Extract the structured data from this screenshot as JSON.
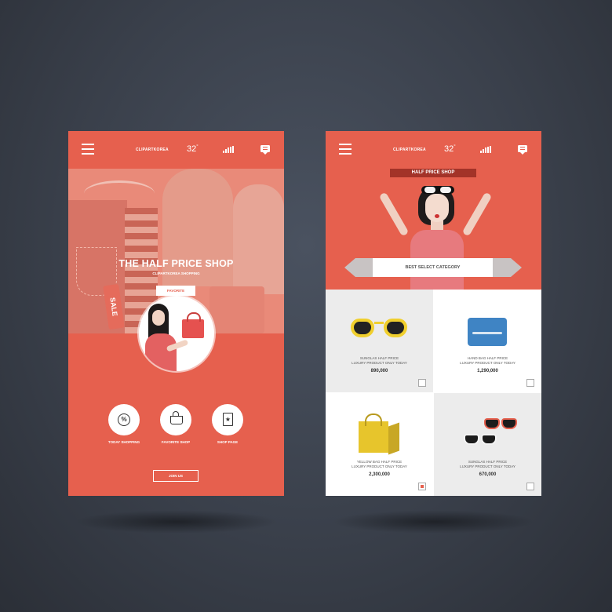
{
  "status_bar": {
    "brand": "CLIPARTKOREA",
    "temperature": "32",
    "degree_symbol": "°"
  },
  "home": {
    "hero_title": "THE HALF PRICE SHOP",
    "hero_subtitle": "CLIPARTKOREA SHOPPING",
    "sale_tag": "SALE",
    "favorite_button": "FAVORITE",
    "nav_items": [
      {
        "label": "TODAY SHOPPING",
        "icon": "percent-icon"
      },
      {
        "label": "FAVORITE SHOP",
        "icon": "basket-icon"
      },
      {
        "label": "SHOP PAGE",
        "icon": "star-page-icon"
      }
    ],
    "join_button": "JOIN US"
  },
  "category": {
    "banner": "HALF PRICE SHOP",
    "category_button": "BEST SELECT CATEGORY",
    "products": [
      {
        "name_line1": "SUNGLAS HALF PRICE",
        "name_line2": "LUXURY PRODUCT ONLY TODAY",
        "price": "890,000",
        "checked": false
      },
      {
        "name_line1": "HAND BAG HALF PRICE",
        "name_line2": "LUXURY PRODUCT ONLY TODAY",
        "price": "1,290,000",
        "checked": false
      },
      {
        "name_line1": "YELLOW BAG HALF PRICE",
        "name_line2": "LUXURY PRODUCT ONLY TODAY",
        "price": "2,300,000",
        "checked": true
      },
      {
        "name_line1": "SUNGLAS HALF PRICE",
        "name_line2": "LUXURY PRODUCT ONLY TODAY",
        "price": "670,000",
        "checked": false
      }
    ]
  },
  "colors": {
    "accent": "#e6604e",
    "banner_dark": "#a33328",
    "card_gray": "#ececec",
    "background": "#3a404b"
  }
}
